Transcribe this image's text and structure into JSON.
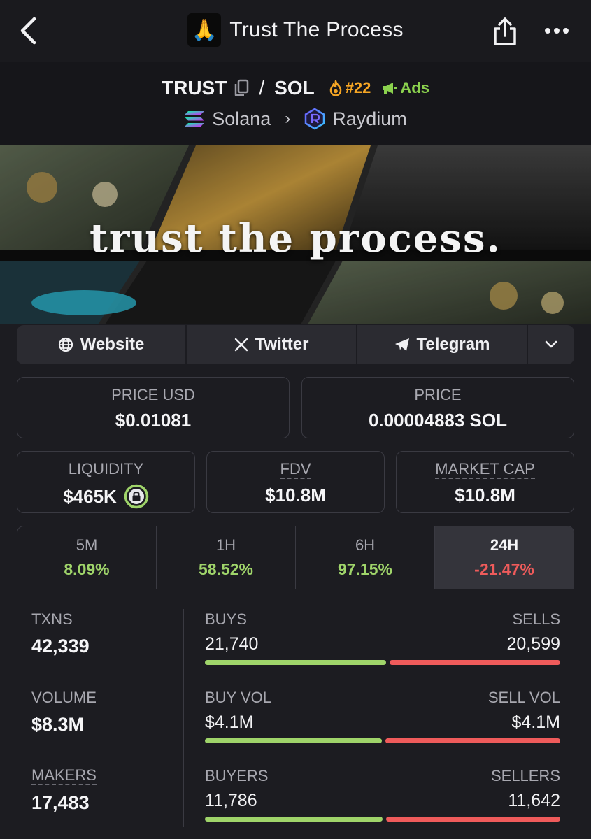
{
  "header": {
    "title": "Trust The Process",
    "avatar_emoji": "🙏"
  },
  "pair": {
    "base": "TRUST",
    "quote": "SOL",
    "separator": "/",
    "rank": "#22",
    "ads_label": "Ads",
    "chain": "Solana",
    "dex": "Raydium"
  },
  "banner": {
    "text": "trust the process."
  },
  "links": {
    "website": "Website",
    "twitter": "Twitter",
    "telegram": "Telegram"
  },
  "price": {
    "usd_label": "PRICE USD",
    "usd_value": "$0.01081",
    "native_label": "PRICE",
    "native_value": "0.00004883 SOL"
  },
  "metrics": {
    "liquidity_label": "LIQUIDITY",
    "liquidity_value": "$465K",
    "fdv_label": "FDV",
    "fdv_value": "$10.8M",
    "mcap_label": "MARKET CAP",
    "mcap_value": "$10.8M"
  },
  "timeframes": [
    {
      "label": "5M",
      "change": "8.09%"
    },
    {
      "label": "1H",
      "change": "58.52%"
    },
    {
      "label": "6H",
      "change": "97.15%"
    },
    {
      "label": "24H",
      "change": "-21.47%"
    }
  ],
  "stats": {
    "txns_label": "TXNS",
    "txns_value": "42,339",
    "volume_label": "VOLUME",
    "volume_value": "$8.3M",
    "makers_label": "MAKERS",
    "makers_value": "17,483",
    "buys_label": "BUYS",
    "buys_value": "21,740",
    "sells_label": "SELLS",
    "sells_value": "20,599",
    "buyvol_label": "BUY VOL",
    "buyvol_value": "$4.1M",
    "sellvol_label": "SELL VOL",
    "sellvol_value": "$4.1M",
    "buyers_label": "BUYERS",
    "buyers_value": "11,786",
    "sellers_label": "SELLERS",
    "sellers_value": "11,642"
  },
  "colors": {
    "positive": "#9fd46a",
    "negative": "#ef5b5b",
    "rank": "#f5a524",
    "ads": "#8bd14e"
  }
}
